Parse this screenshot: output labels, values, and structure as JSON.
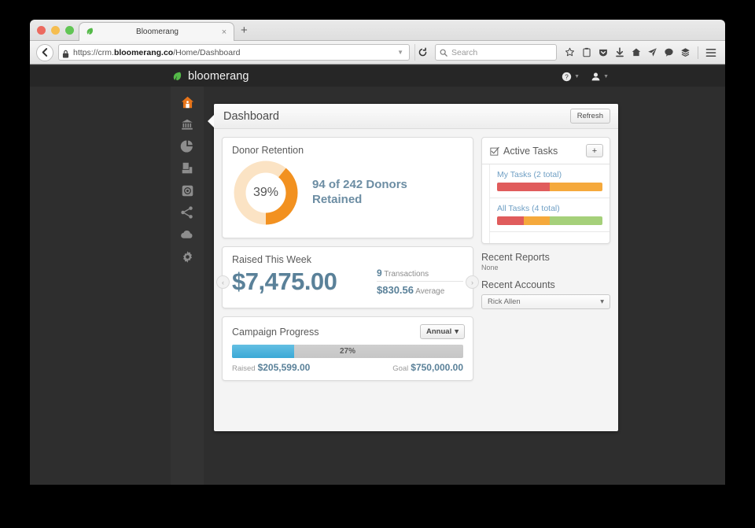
{
  "browser": {
    "tab": {
      "title": "Bloomerang",
      "close_label": "×",
      "favicon": "bloomerang-leaf-icon"
    },
    "newtab_label": "+",
    "url": {
      "scheme": "https://crm.",
      "domain": "bloomerang.co",
      "path": "/Home/Dashboard"
    },
    "search_placeholder": "Search",
    "toolbar_icons": [
      "bookmark-star-icon",
      "reader-view-icon",
      "pocket-icon",
      "downloads-icon",
      "home-icon",
      "send-tab-icon",
      "chat-icon",
      "sync-stack-icon",
      "menu-hamburger-icon"
    ]
  },
  "app": {
    "brand": "bloomerang",
    "help_label": "?",
    "sidebar": [
      {
        "name": "home",
        "label": "Home",
        "active": true
      },
      {
        "name": "constituents",
        "label": "Constituents",
        "active": false
      },
      {
        "name": "reports",
        "label": "Reports",
        "active": false
      },
      {
        "name": "transactions",
        "label": "Transactions",
        "active": false
      },
      {
        "name": "email",
        "label": "Email",
        "active": false
      },
      {
        "name": "share",
        "label": "Share",
        "active": false
      },
      {
        "name": "cloud",
        "label": "Cloud",
        "active": false
      },
      {
        "name": "settings",
        "label": "Settings",
        "active": false
      }
    ]
  },
  "header": {
    "title": "Dashboard",
    "refresh_label": "Refresh"
  },
  "donor_retention": {
    "title": "Donor Retention",
    "percent_label": "39%",
    "summary_line1": "94 of 242 Donors",
    "summary_line2": "Retained",
    "arc_color": "#F29120",
    "track_color": "#FBE3C4"
  },
  "raised_this_week": {
    "title": "Raised This Week",
    "amount": "$7,475.00",
    "transactions_count": "9",
    "transactions_label": "Transactions",
    "average_amount": "$830.56",
    "average_label": "Average",
    "prev_label": "‹",
    "next_label": "›"
  },
  "campaign_progress": {
    "title": "Campaign Progress",
    "period_label": "Annual",
    "percent_label": "27%",
    "raised_label": "Raised",
    "raised_amount": "$205,599.00",
    "goal_label": "Goal",
    "goal_amount": "$750,000.00",
    "bar_color": "#3ba9d6"
  },
  "active_tasks": {
    "title": "Active Tasks",
    "add_label": "+",
    "rows": [
      {
        "label": "My Tasks (2 total)",
        "segments": [
          {
            "name": "overdue",
            "color": "#e05c5c",
            "pct": 50
          },
          {
            "name": "due",
            "color": "#f5a93c",
            "pct": 50
          }
        ]
      },
      {
        "label": "All Tasks (4 total)",
        "segments": [
          {
            "name": "overdue",
            "color": "#e05c5c",
            "pct": 25
          },
          {
            "name": "due",
            "color": "#f5a93c",
            "pct": 25
          },
          {
            "name": "upcoming",
            "color": "#a5d07a",
            "pct": 50
          }
        ]
      }
    ]
  },
  "recent_reports": {
    "title": "Recent Reports",
    "empty_label": "None"
  },
  "recent_accounts": {
    "title": "Recent Accounts",
    "selected": "Rick Allen"
  }
}
